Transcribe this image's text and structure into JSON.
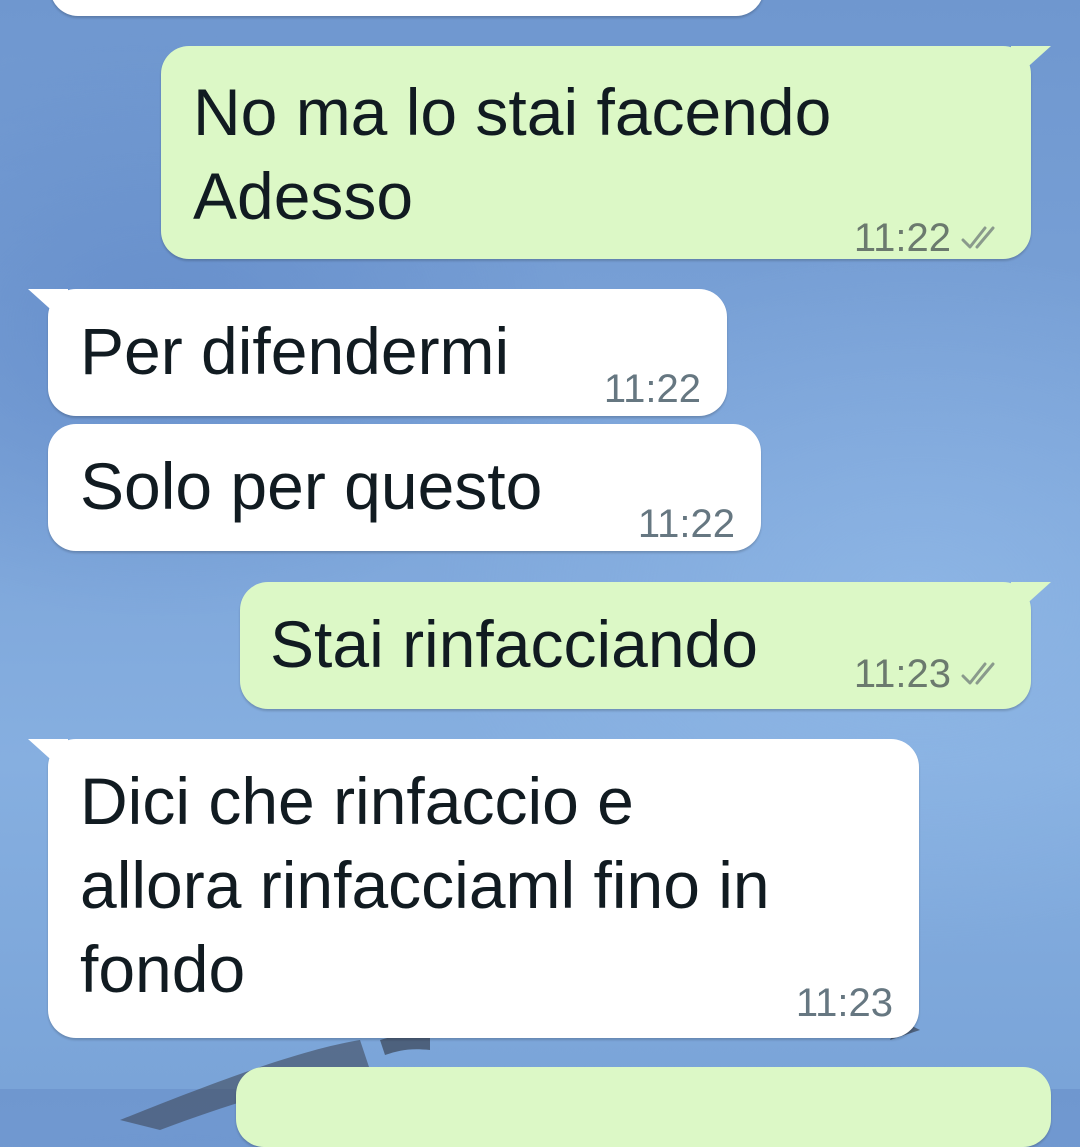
{
  "messages": [
    {
      "direction": "in",
      "text": "",
      "time": ""
    },
    {
      "direction": "out",
      "text": "No ma lo stai facendo\nAdesso",
      "time": "11:22",
      "status": "read"
    },
    {
      "direction": "in",
      "text": "Per difendermi",
      "time": "11:22"
    },
    {
      "direction": "in",
      "text": "Solo per questo",
      "time": "11:22"
    },
    {
      "direction": "out",
      "text": "Stai rinfacciando",
      "time": "11:23",
      "status": "read"
    },
    {
      "direction": "in",
      "text": "Dici che rinfaccio e\nallora rinfacciaml fino in\nfondo",
      "time": "11:23"
    },
    {
      "direction": "out",
      "text": "",
      "time": ""
    }
  ],
  "colors": {
    "incoming_bubble": "#ffffff",
    "outgoing_bubble": "#dcf8c6",
    "timestamp": "#667781",
    "wallpaper": "#7ba3d8"
  }
}
